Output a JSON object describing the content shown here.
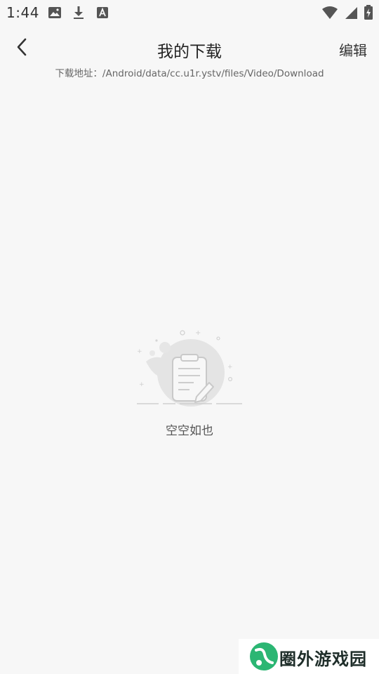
{
  "status_bar": {
    "time": "1:44",
    "icons_left": [
      "image-icon",
      "download-icon",
      "font-icon"
    ],
    "icons_right": [
      "wifi-icon",
      "signal-icon",
      "battery-icon"
    ]
  },
  "header": {
    "back_icon": "chevron-left-icon",
    "title": "我的下载",
    "edit_label": "编辑",
    "download_path": "下载地址：/Android/data/cc.u1r.ystv/files/Video/Download"
  },
  "empty_state": {
    "illustration_icon": "clipboard-edit-icon",
    "message": "空空如也"
  },
  "watermark": {
    "text": "圈外游戏园",
    "logo_color": "#2bb673"
  },
  "colors": {
    "background": "#f7f7f7",
    "illustration_gray": "#d9d9d9"
  }
}
